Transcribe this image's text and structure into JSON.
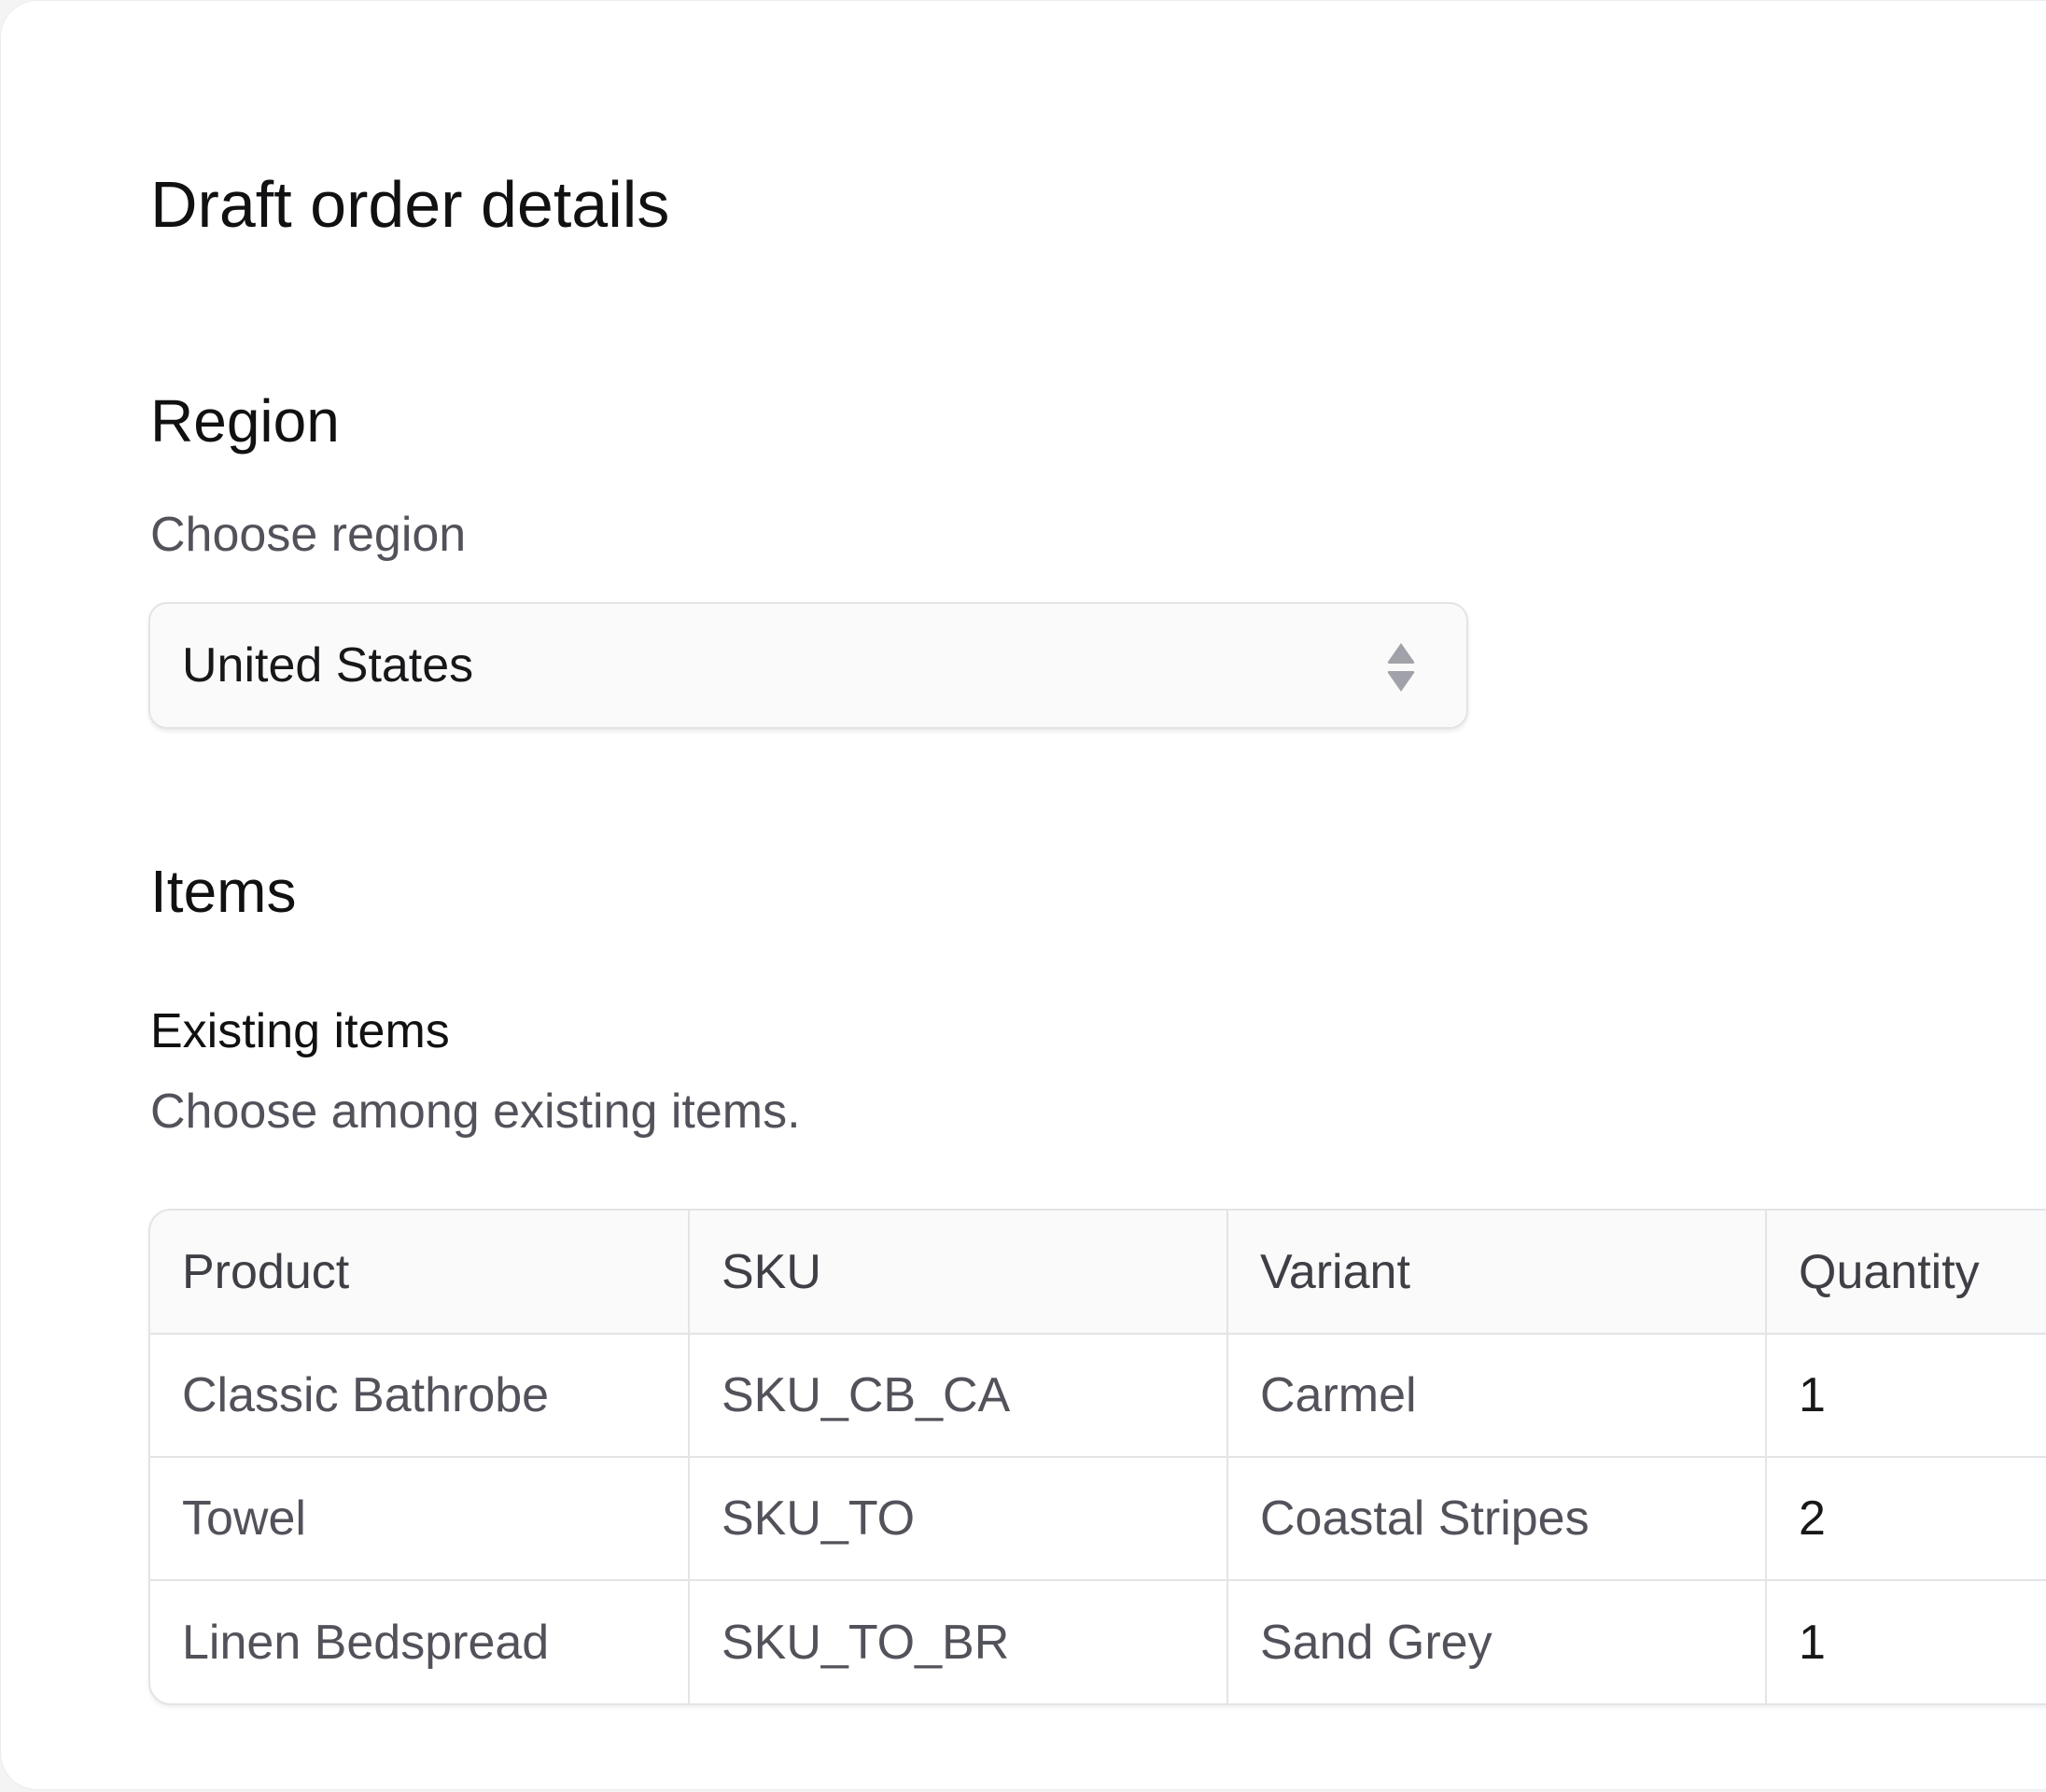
{
  "page": {
    "title": "Draft order details"
  },
  "region": {
    "heading": "Region",
    "label": "Choose region",
    "selected": "United States",
    "icon": "chevron-up-down-icon"
  },
  "items": {
    "heading": "Items",
    "existing": {
      "heading": "Existing items",
      "description": "Choose among existing items."
    },
    "table": {
      "columns": [
        "Product",
        "SKU",
        "Variant",
        "Quantity"
      ],
      "rows": [
        {
          "product": "Classic Bathrobe",
          "sku": "SKU_CB_CA",
          "variant": "Carmel",
          "quantity": "1"
        },
        {
          "product": "Towel",
          "sku": "SKU_TO",
          "variant": "Coastal Stripes",
          "quantity": "2"
        },
        {
          "product": "Linen Bedspread",
          "sku": "SKU_TO_BR",
          "variant": "Sand Grey",
          "quantity": "1"
        }
      ]
    }
  },
  "colors": {
    "text_primary": "#111113",
    "text_secondary": "#52525b",
    "border": "#e4e4e7",
    "field_background": "#fafafa"
  }
}
